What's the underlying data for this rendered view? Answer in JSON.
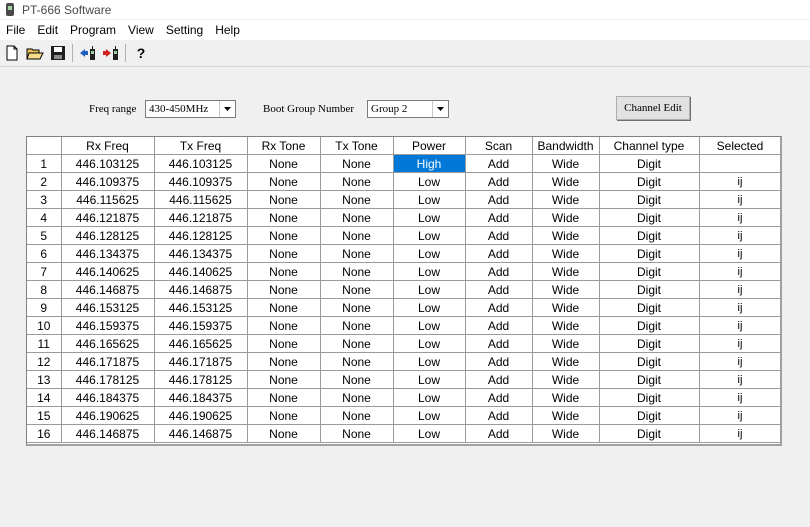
{
  "window": {
    "title": "PT-666 Software"
  },
  "menu": [
    "File",
    "Edit",
    "Program",
    "View",
    "Setting",
    "Help"
  ],
  "toolbar": {
    "buttons": [
      {
        "icon": "new-file-icon"
      },
      {
        "icon": "open-folder-icon"
      },
      {
        "icon": "save-icon"
      },
      {
        "icon": "read-from-radio-icon"
      },
      {
        "icon": "write-to-radio-icon"
      },
      {
        "icon": "help-icon"
      }
    ]
  },
  "controls": {
    "freq_range_label": "Freq range",
    "freq_range_value": "430-450MHz",
    "boot_group_label": "Boot Group Number",
    "boot_group_value": "Group 2",
    "channel_edit_label": "Channel Edit"
  },
  "table": {
    "headers": [
      "",
      "Rx Freq",
      "Tx Freq",
      "Rx Tone",
      "Tx Tone",
      "Power",
      "Scan",
      "Bandwidth",
      "Channel type",
      "Selected"
    ],
    "rows": [
      [
        "1",
        "446.103125",
        "446.103125",
        "None",
        "None",
        "High",
        "Add",
        "Wide",
        "Digit",
        ""
      ],
      [
        "2",
        "446.109375",
        "446.109375",
        "None",
        "None",
        "Low",
        "Add",
        "Wide",
        "Digit",
        "ij"
      ],
      [
        "3",
        "446.115625",
        "446.115625",
        "None",
        "None",
        "Low",
        "Add",
        "Wide",
        "Digit",
        "ij"
      ],
      [
        "4",
        "446.121875",
        "446.121875",
        "None",
        "None",
        "Low",
        "Add",
        "Wide",
        "Digit",
        "ij"
      ],
      [
        "5",
        "446.128125",
        "446.128125",
        "None",
        "None",
        "Low",
        "Add",
        "Wide",
        "Digit",
        "ij"
      ],
      [
        "6",
        "446.134375",
        "446.134375",
        "None",
        "None",
        "Low",
        "Add",
        "Wide",
        "Digit",
        "ij"
      ],
      [
        "7",
        "446.140625",
        "446.140625",
        "None",
        "None",
        "Low",
        "Add",
        "Wide",
        "Digit",
        "ij"
      ],
      [
        "8",
        "446.146875",
        "446.146875",
        "None",
        "None",
        "Low",
        "Add",
        "Wide",
        "Digit",
        "ij"
      ],
      [
        "9",
        "446.153125",
        "446.153125",
        "None",
        "None",
        "Low",
        "Add",
        "Wide",
        "Digit",
        "ij"
      ],
      [
        "10",
        "446.159375",
        "446.159375",
        "None",
        "None",
        "Low",
        "Add",
        "Wide",
        "Digit",
        "ij"
      ],
      [
        "11",
        "446.165625",
        "446.165625",
        "None",
        "None",
        "Low",
        "Add",
        "Wide",
        "Digit",
        "ij"
      ],
      [
        "12",
        "446.171875",
        "446.171875",
        "None",
        "None",
        "Low",
        "Add",
        "Wide",
        "Digit",
        "ij"
      ],
      [
        "13",
        "446.178125",
        "446.178125",
        "None",
        "None",
        "Low",
        "Add",
        "Wide",
        "Digit",
        "ij"
      ],
      [
        "14",
        "446.184375",
        "446.184375",
        "None",
        "None",
        "Low",
        "Add",
        "Wide",
        "Digit",
        "ij"
      ],
      [
        "15",
        "446.190625",
        "446.190625",
        "None",
        "None",
        "Low",
        "Add",
        "Wide",
        "Digit",
        "ij"
      ],
      [
        "16",
        "446.146875",
        "446.146875",
        "None",
        "None",
        "Low",
        "Add",
        "Wide",
        "Digit",
        "ij"
      ]
    ],
    "highlight": {
      "row": 0,
      "col": 5,
      "color": "#0078d7"
    }
  }
}
